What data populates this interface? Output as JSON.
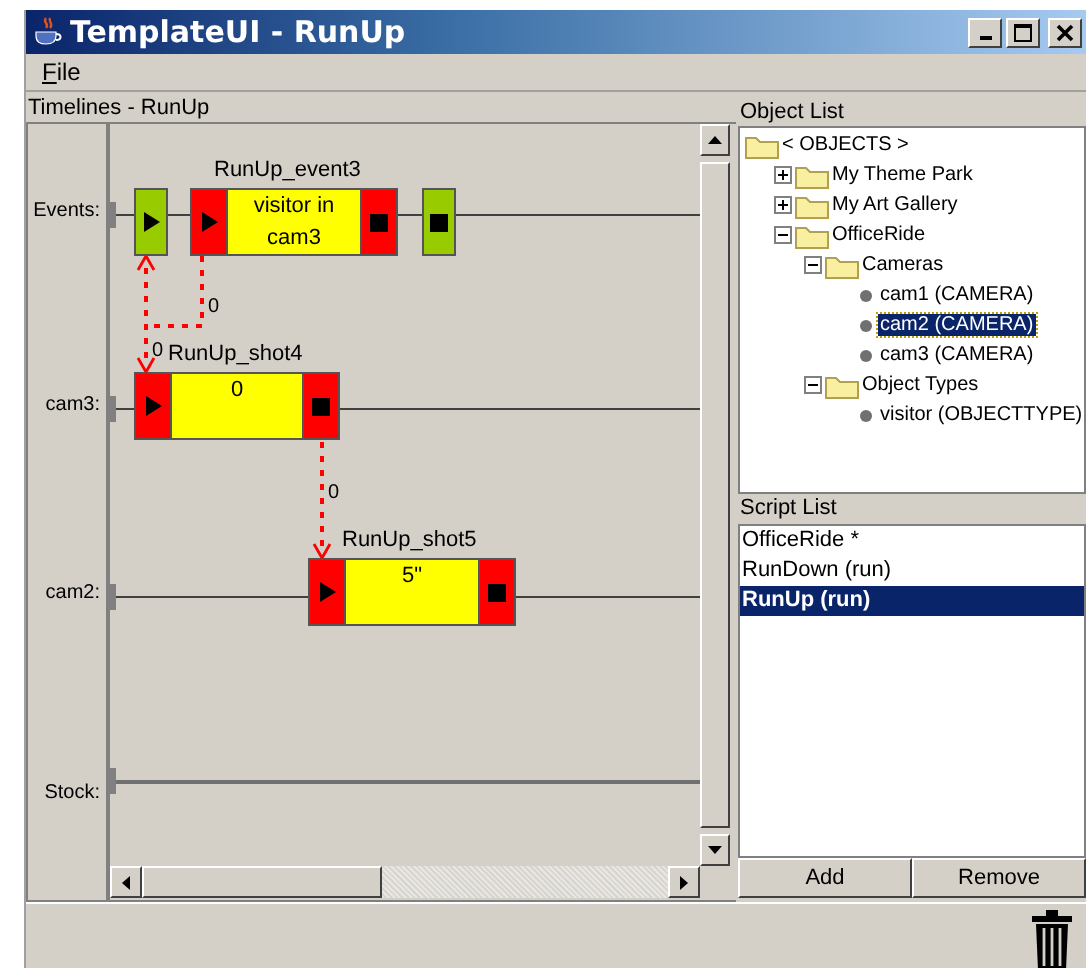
{
  "window": {
    "title": "TemplateUI - RunUp"
  },
  "menu": [
    "File"
  ],
  "timelines": {
    "title": "Timelines - RunUp",
    "lanes": [
      "Events:",
      "cam3:",
      "cam2:",
      "Stock:"
    ],
    "blocks": [
      {
        "kind": "trigger-start"
      },
      {
        "kind": "event",
        "name": "RunUp_event3",
        "text": "visitor in cam3"
      },
      {
        "kind": "trigger-end"
      },
      {
        "kind": "shot",
        "name": "RunUp_shot4",
        "text": "0"
      },
      {
        "kind": "shot",
        "name": "RunUp_shot5",
        "text": "5\""
      }
    ],
    "connectors": [
      {
        "label": "0"
      },
      {
        "label": "0"
      },
      {
        "label": "0"
      }
    ]
  },
  "object_list": {
    "title": "Object List",
    "tree": [
      {
        "label": "< OBJECTS >",
        "kind": "folder",
        "selected": false,
        "children": [
          {
            "label": "My Theme Park",
            "kind": "folder",
            "expanded": false,
            "selected": false
          },
          {
            "label": "My Art Gallery",
            "kind": "folder",
            "expanded": false,
            "selected": false
          },
          {
            "label": "OfficeRide",
            "kind": "folder",
            "expanded": true,
            "selected": false,
            "children": [
              {
                "label": "Cameras",
                "kind": "folder",
                "expanded": true,
                "selected": false,
                "children": [
                  {
                    "label": "cam1 (CAMERA)",
                    "kind": "item",
                    "selected": false
                  },
                  {
                    "label": "cam2 (CAMERA)",
                    "kind": "item",
                    "selected": true
                  },
                  {
                    "label": "cam3 (CAMERA)",
                    "kind": "item",
                    "selected": false
                  }
                ]
              },
              {
                "label": "Object Types",
                "kind": "folder",
                "expanded": true,
                "selected": false,
                "children": [
                  {
                    "label": "visitor (OBJECTTYPE)",
                    "kind": "item",
                    "selected": false
                  }
                ]
              }
            ]
          }
        ]
      }
    ]
  },
  "script_list": {
    "title": "Script List",
    "items": [
      {
        "label": "OfficeRide *",
        "selected": false
      },
      {
        "label": "RunDown (run)",
        "selected": false
      },
      {
        "label": "RunUp (run)",
        "selected": true
      }
    ]
  },
  "buttons": [
    "Add",
    "Remove"
  ]
}
